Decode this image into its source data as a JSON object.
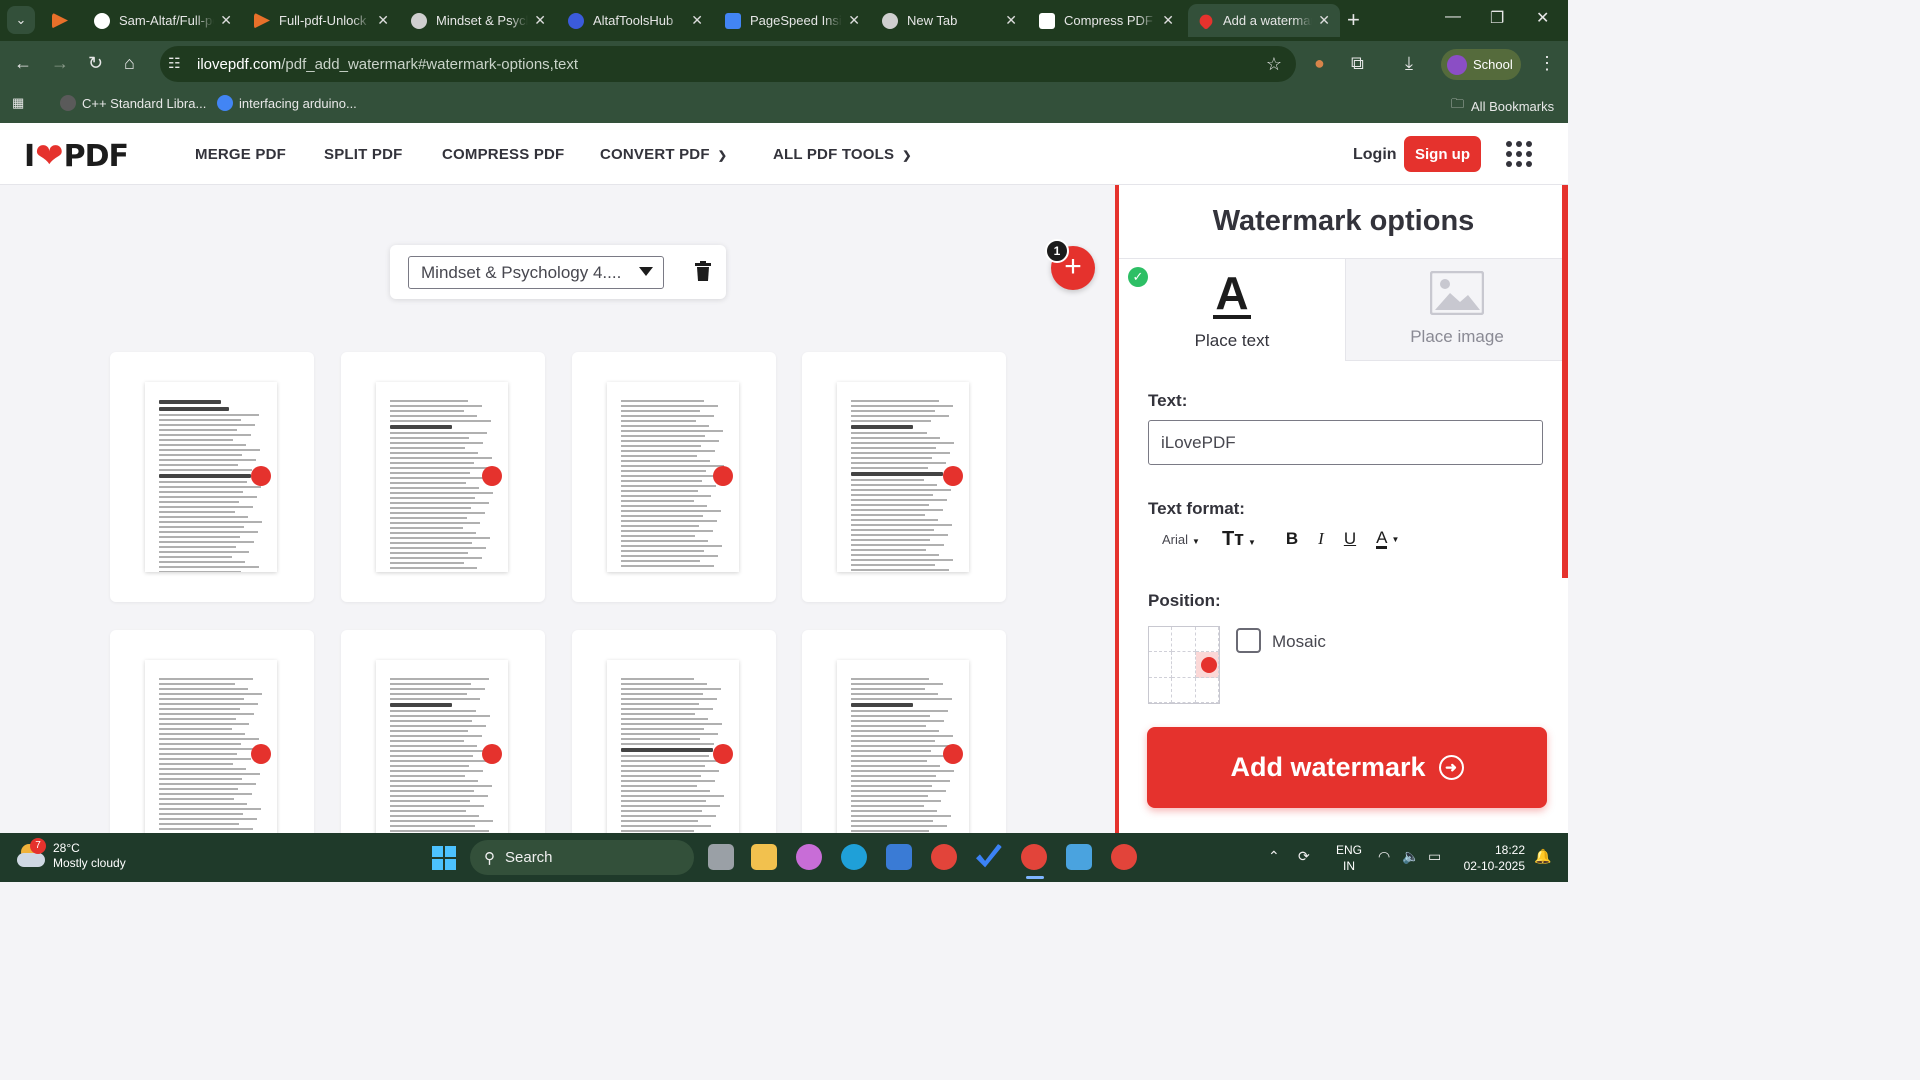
{
  "browser": {
    "tabs": [
      {
        "label": "",
        "favicon_color": "#e8702a"
      },
      {
        "label": "Sam-Altaf/Full-pdf-Unlock",
        "favicon_color": "#ffffff"
      },
      {
        "label": "Full-pdf-Unlock",
        "favicon_color": "#e8702a"
      },
      {
        "label": "Mindset & Psychology",
        "favicon_color": "#cfcfcf"
      },
      {
        "label": "AltafToolsHub",
        "favicon_color": "#3b5bdb"
      },
      {
        "label": "PageSpeed Insights",
        "favicon_color": "#4285f4"
      },
      {
        "label": "New Tab",
        "favicon_color": "#cfcfcf"
      },
      {
        "label": "Compress PDF",
        "favicon_color": "#ffffff"
      },
      {
        "label": "Add a watermark",
        "favicon_color": "#e5322d"
      }
    ],
    "url_host": "ilovepdf.com",
    "url_path": "/pdf_add_watermark#watermark-options,text",
    "profile_label": "School",
    "bookmarks": [
      {
        "label": "C++ Standard Libra...",
        "icon_color": "#5a5a5a"
      },
      {
        "label": "interfacing arduino...",
        "icon_color": "#4285f4"
      }
    ],
    "all_bookmarks": "All Bookmarks"
  },
  "site": {
    "logo_left": "I",
    "logo_right": "PDF",
    "nav": [
      "MERGE PDF",
      "SPLIT PDF",
      "COMPRESS PDF",
      "CONVERT PDF",
      "ALL PDF TOOLS"
    ],
    "login": "Login",
    "signup": "Sign up",
    "brand_color": "#e5322d"
  },
  "workspace": {
    "selected_file": "Mindset & Psychology 4....",
    "file_count": "1",
    "page_count": 8
  },
  "sidebar": {
    "title": "Watermark options",
    "mode_text": "Place text",
    "mode_image": "Place image",
    "text_label": "Text:",
    "text_value": "iLovePDF",
    "format_label": "Text format:",
    "font": "Arial",
    "position_label": "Position:",
    "position_selected": "middle-right",
    "mosaic_label": "Mosaic",
    "mosaic_checked": false,
    "submit": "Add watermark"
  },
  "taskbar": {
    "weather_temp": "28°C",
    "weather_desc": "Mostly cloudy",
    "weather_badge": "7",
    "search": "Search",
    "lang_top": "ENG",
    "lang_bottom": "IN",
    "time": "18:22",
    "date": "02-10-2025"
  }
}
